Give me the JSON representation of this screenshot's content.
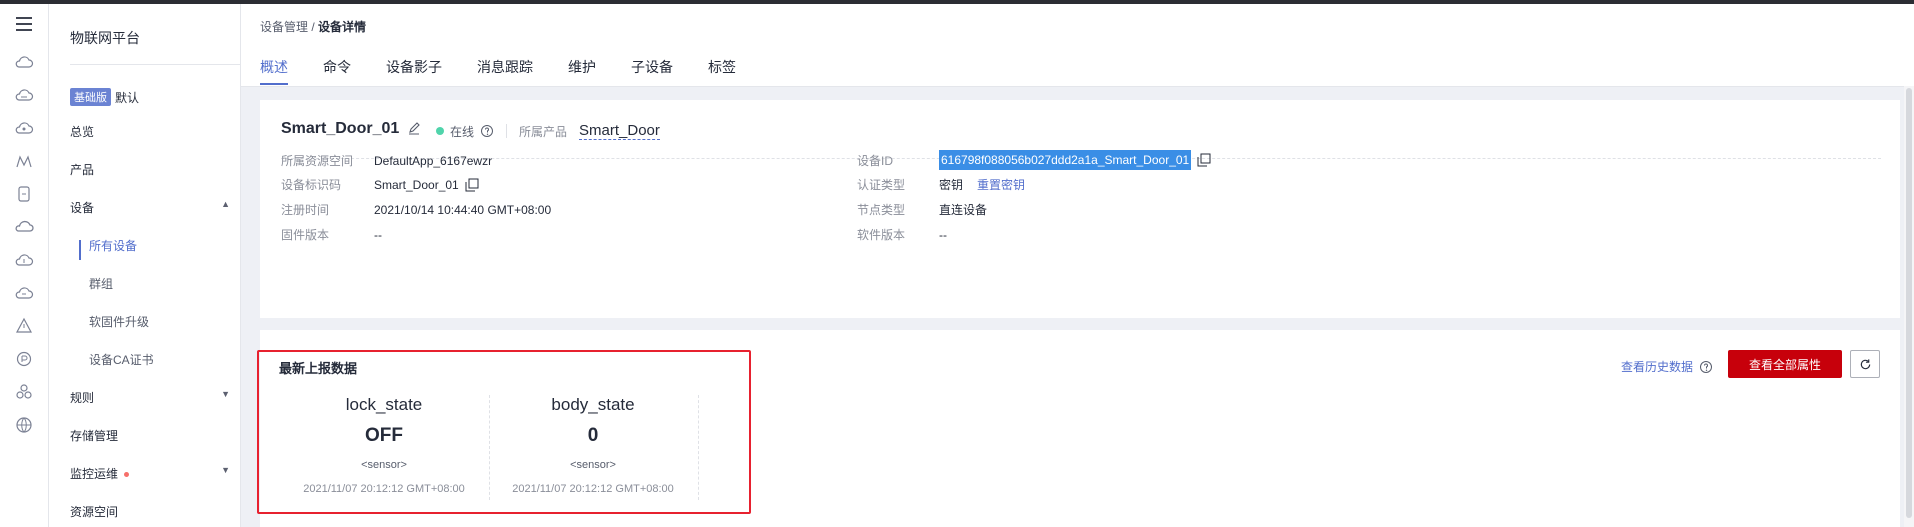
{
  "app": {
    "title": "物联网平台",
    "edition_badge": "基础版",
    "edition_name": "默认"
  },
  "rail": {
    "icons": [
      "menu-icon",
      "cloud-icon",
      "cloud-icon",
      "cloud-icon",
      "monitor-icon",
      "mobile-icon",
      "cloud-icon",
      "cloud-icon",
      "cloud-icon",
      "warning-icon",
      "circle-icon",
      "apps-icon",
      "globe-icon"
    ]
  },
  "nav": {
    "overview": "总览",
    "product": "产品",
    "device": "设备",
    "sub": [
      "所有设备",
      "群组",
      "软固件升级",
      "设备CA证书"
    ],
    "rules": "规则",
    "storage": "存储管理",
    "monitor": "监控运维",
    "resource": "资源空间"
  },
  "breadcrumb": {
    "parent": "设备管理",
    "sep": " / ",
    "current": "设备详情"
  },
  "tabs": [
    "概述",
    "命令",
    "设备影子",
    "消息跟踪",
    "维护",
    "子设备",
    "标签"
  ],
  "device": {
    "name": "Smart_Door_01",
    "status": "在线",
    "product_label": "所属产品",
    "product": "Smart_Door",
    "left": [
      {
        "k": "所属资源空间",
        "v": "DefaultApp_6167ewzr"
      },
      {
        "k": "设备标识码",
        "v": "Smart_Door_01"
      },
      {
        "k": "注册时间",
        "v": "2021/10/14 10:44:40 GMT+08:00"
      },
      {
        "k": "固件版本",
        "v": "--"
      }
    ],
    "right": [
      {
        "k": "设备ID",
        "v": "616798f088056b027ddd2a1a_Smart_Door_01"
      },
      {
        "k": "认证类型",
        "v": "密钥",
        "link": "重置密钥"
      },
      {
        "k": "节点类型",
        "v": "直连设备"
      },
      {
        "k": "软件版本",
        "v": "--"
      }
    ]
  },
  "latest": {
    "title": "最新上报数据",
    "history_link": "查看历史数据",
    "view_all_button": "查看全部属性",
    "props": [
      {
        "name": "lock_state",
        "value": "OFF",
        "type": "<sensor>",
        "time": "2021/11/07 20:12:12 GMT+08:00"
      },
      {
        "name": "body_state",
        "value": "0",
        "type": "<sensor>",
        "time": "2021/11/07 20:12:12 GMT+08:00"
      }
    ]
  },
  "colors": {
    "accent": "#526ecc",
    "primary_button": "#c7000b",
    "online": "#50d4ab",
    "highlight_box": "#e7212f"
  }
}
